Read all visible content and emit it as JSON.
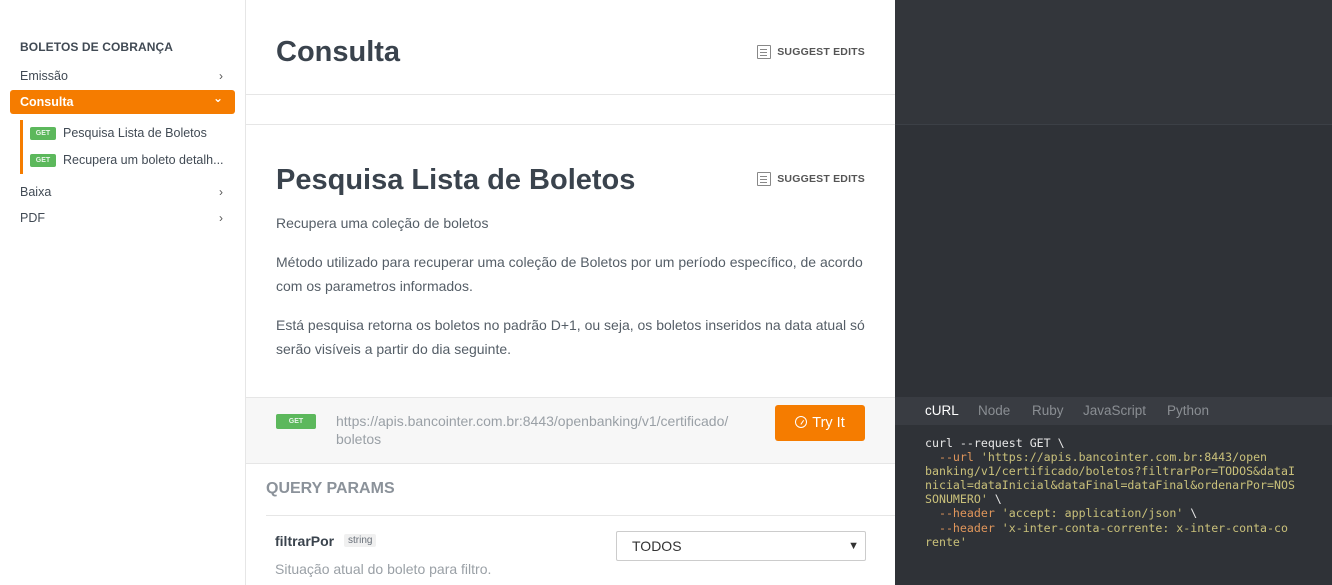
{
  "sidebar": {
    "heading": "BOLETOS DE COBRANÇA",
    "items": [
      {
        "label": "Emissão",
        "chevron": "›"
      },
      {
        "label": "Consulta",
        "chevron": "⌄"
      },
      {
        "label": "Baixa",
        "chevron": "›"
      },
      {
        "label": "PDF",
        "chevron": "›"
      }
    ],
    "sub_items": [
      {
        "badge": "GET",
        "label": "Pesquisa Lista de Boletos"
      },
      {
        "badge": "GET",
        "label": "Recupera um boleto detalh..."
      }
    ]
  },
  "main": {
    "title": "Consulta",
    "suggest_edits": "SUGGEST EDITS",
    "endpoint": {
      "title": "Pesquisa Lista de Boletos",
      "suggest_edits": "SUGGEST EDITS",
      "summary": "Recupera uma coleção de boletos",
      "description_1": "Método utilizado para recuperar uma coleção de Boletos por um período específico, de acordo com os parametros informados.",
      "description_2": "Está pesquisa retorna os boletos no padrão D+1, ou seja, os boletos inseridos na data atual só serão visíveis a partir do dia seguinte.",
      "method": "GET",
      "url": "https://apis.bancointer.com.br:8443/openbanking/v1/certificado/boletos",
      "try_it_label": "Try It"
    },
    "query_params": {
      "heading": "QUERY PARAMS",
      "params": [
        {
          "name": "filtrarPor",
          "type": "string",
          "description": "Situação atual do boleto para filtro.",
          "selected": "TODOS"
        }
      ]
    }
  },
  "code_panel": {
    "languages": [
      "cURL",
      "Node",
      "Ruby",
      "JavaScript",
      "Python"
    ],
    "active_language": "cURL",
    "lines": {
      "l1": "curl --request GET \\",
      "l2_flag": "  --url",
      "l2_str": " 'https://apis.bancointer.com.br:8443/open",
      "l3": "banking/v1/certificado/boletos?filtrarPor=TODOS&dataI",
      "l4": "nicial=dataInicial&dataFinal=dataFinal&ordenarPor=NOS",
      "l5_str": "SONUMERO'",
      "l5_rest": " \\",
      "l6_flag": "  --header",
      "l6_str": " 'accept: application/json'",
      "l6_rest": " \\",
      "l7_flag": "  --header",
      "l7_str": " 'x-inter-conta-corrente: x-inter-conta-co",
      "l8": "rente'"
    }
  }
}
